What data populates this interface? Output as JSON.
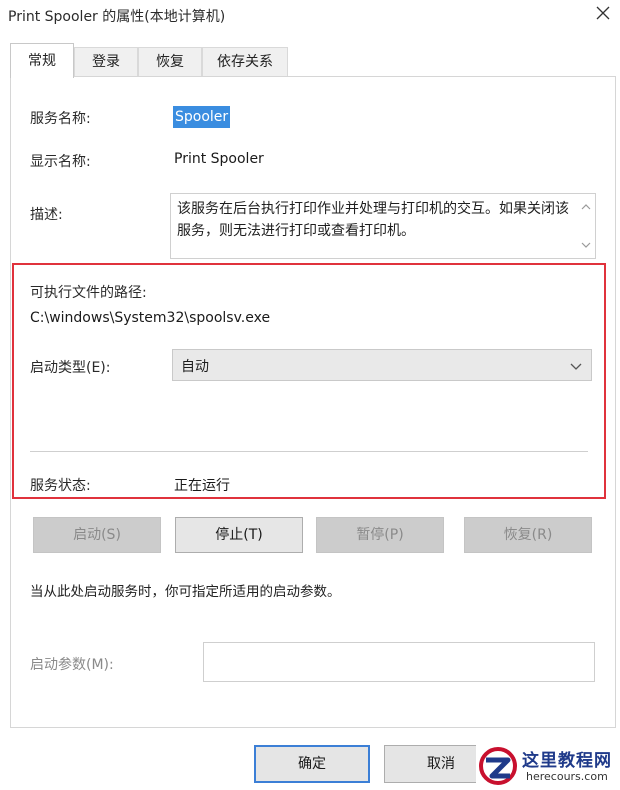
{
  "window": {
    "title": "Print Spooler 的属性(本地计算机)",
    "close_glyph": "✕"
  },
  "tabs": [
    {
      "label": "常规",
      "active": true
    },
    {
      "label": "登录",
      "active": false
    },
    {
      "label": "恢复",
      "active": false
    },
    {
      "label": "依存关系",
      "active": false
    }
  ],
  "general": {
    "service_name_label": "服务名称:",
    "service_name_value": "Spooler",
    "display_name_label": "显示名称:",
    "display_name_value": "Print Spooler",
    "description_label": "描述:",
    "description_value": "该服务在后台执行打印作业并处理与打印机的交互。如果关闭该服务，则无法进行打印或查看打印机。",
    "exe_path_label": "可执行文件的路径:",
    "exe_path_value": "C:\\windows\\System32\\spoolsv.exe",
    "startup_type_label": "启动类型(E):",
    "startup_type_value": "自动",
    "service_status_label": "服务状态:",
    "service_status_value": "正在运行"
  },
  "buttons": {
    "start": "启动(S)",
    "stop": "停止(T)",
    "pause": "暂停(P)",
    "resume": "恢复(R)"
  },
  "hint": "当从此处启动服务时，你可指定所适用的启动参数。",
  "start_params": {
    "label": "启动参数(M):",
    "value": ""
  },
  "footer": {
    "ok": "确定",
    "cancel": "取消"
  },
  "watermark": {
    "title": "这里教程网",
    "subtitle": "herecours.com"
  },
  "colors": {
    "selection": "#3a8de0",
    "highlight_frame": "#e0323c",
    "default_button_border": "#3c7fd6"
  }
}
